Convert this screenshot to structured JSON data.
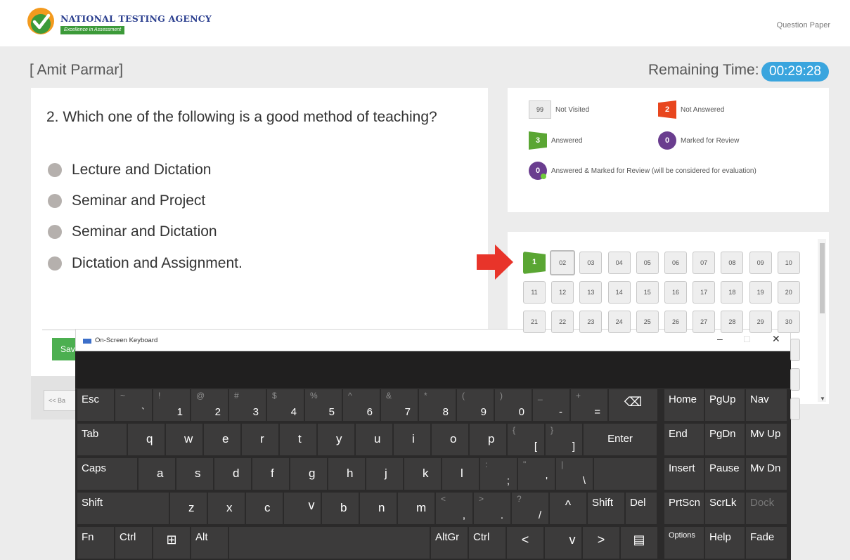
{
  "header": {
    "agency": "NATIONAL TESTING AGENCY",
    "tagline": "Excellence in Assessment",
    "question_paper": "Question Paper"
  },
  "candidate": {
    "name": "[ Amit Parmar]"
  },
  "timer": {
    "label": "Remaining Time:",
    "value": "00:29:28"
  },
  "question": {
    "text": "2. Which one of the following is a good method of teaching?",
    "options": [
      "Lecture and Dictation",
      "Seminar and Project",
      "Seminar and Dictation",
      "Dictation and Assignment."
    ]
  },
  "buttons": {
    "save": "Sav",
    "back": "<< Ba"
  },
  "legend": {
    "not_visited": {
      "count": "99",
      "label": "Not Visited"
    },
    "not_answered": {
      "count": "2",
      "label": "Not Answered"
    },
    "answered": {
      "count": "3",
      "label": "Answered"
    },
    "marked": {
      "count": "0",
      "label": "Marked for Review"
    },
    "answered_marked": {
      "count": "0",
      "label": "Answered & Marked for Review (will be considered for evaluation)"
    },
    "colors": {
      "red": "#e8461e",
      "green": "#5aa633",
      "purple": "#6a3d8f",
      "timer": "#3aa5de"
    }
  },
  "palette": {
    "current_question": "02",
    "buttons": [
      "1",
      "02",
      "03",
      "04",
      "05",
      "06",
      "07",
      "08",
      "09",
      "10",
      "11",
      "12",
      "13",
      "14",
      "15",
      "16",
      "17",
      "18",
      "19",
      "20",
      "21",
      "22",
      "23",
      "24",
      "25",
      "26",
      "27",
      "28",
      "29",
      "30"
    ]
  },
  "keyboard": {
    "title": "On-Screen Keyboard",
    "controls": {
      "minimize": "–",
      "maximize": "□",
      "close": "✕"
    },
    "rows": [
      [
        {
          "primary": "Esc"
        },
        {
          "secondary": "~",
          "primary": "`"
        },
        {
          "secondary": "!",
          "primary": "1"
        },
        {
          "secondary": "@",
          "primary": "2"
        },
        {
          "secondary": "#",
          "primary": "3"
        },
        {
          "secondary": "$",
          "primary": "4"
        },
        {
          "secondary": "%",
          "primary": "5"
        },
        {
          "secondary": "^",
          "primary": "6"
        },
        {
          "secondary": "&",
          "primary": "7"
        },
        {
          "secondary": "*",
          "primary": "8"
        },
        {
          "secondary": "(",
          "primary": "9"
        },
        {
          "secondary": ")",
          "primary": "0"
        },
        {
          "secondary": "_",
          "primary": "-"
        },
        {
          "secondary": "+",
          "primary": "="
        },
        {
          "primary": "⌫"
        },
        {
          "primary": "Home"
        },
        {
          "primary": "PgUp"
        },
        {
          "primary": "Nav"
        }
      ],
      [
        {
          "primary": "Tab"
        },
        {
          "primary": "q"
        },
        {
          "primary": "w"
        },
        {
          "primary": "e"
        },
        {
          "primary": "r"
        },
        {
          "primary": "t"
        },
        {
          "primary": "y"
        },
        {
          "primary": "u"
        },
        {
          "primary": "i"
        },
        {
          "primary": "o"
        },
        {
          "primary": "p"
        },
        {
          "secondary": "{",
          "primary": "["
        },
        {
          "secondary": "}",
          "primary": "]"
        },
        {
          "primary": "Enter"
        },
        {
          "primary": "End"
        },
        {
          "primary": "PgDn"
        },
        {
          "primary": "Mv Up"
        }
      ],
      [
        {
          "primary": "Caps"
        },
        {
          "primary": "a"
        },
        {
          "primary": "s"
        },
        {
          "primary": "d"
        },
        {
          "primary": "f"
        },
        {
          "primary": "g"
        },
        {
          "primary": "h"
        },
        {
          "primary": "j"
        },
        {
          "primary": "k"
        },
        {
          "primary": "l"
        },
        {
          "secondary": ":",
          "primary": ";"
        },
        {
          "secondary": "\"",
          "primary": "'"
        },
        {
          "secondary": "|",
          "primary": "\\"
        },
        {
          "primary": ""
        },
        {
          "primary": "Insert"
        },
        {
          "primary": "Pause"
        },
        {
          "primary": "Mv Dn"
        }
      ],
      [
        {
          "primary": "Shift"
        },
        {
          "primary": "z"
        },
        {
          "primary": "x"
        },
        {
          "primary": "c"
        },
        {
          "primary": "v"
        },
        {
          "primary": "b"
        },
        {
          "primary": "n"
        },
        {
          "primary": "m"
        },
        {
          "secondary": "<",
          "primary": ","
        },
        {
          "secondary": ">",
          "primary": "."
        },
        {
          "secondary": "?",
          "primary": "/"
        },
        {
          "primary": "^"
        },
        {
          "primary": "Shift"
        },
        {
          "primary": "Del"
        },
        {
          "primary": "PrtScn"
        },
        {
          "primary": "ScrLk"
        },
        {
          "primary": "Dock"
        }
      ],
      [
        {
          "primary": "Fn"
        },
        {
          "primary": "Ctrl"
        },
        {
          "primary": "⊞"
        },
        {
          "primary": "Alt"
        },
        {
          "primary": ""
        },
        {
          "primary": "AltGr"
        },
        {
          "primary": "Ctrl"
        },
        {
          "primary": "<"
        },
        {
          "primary": "v"
        },
        {
          "primary": ">"
        },
        {
          "primary": "▤"
        },
        {
          "primary": "Options"
        },
        {
          "primary": "Help"
        },
        {
          "primary": "Fade"
        }
      ]
    ]
  }
}
